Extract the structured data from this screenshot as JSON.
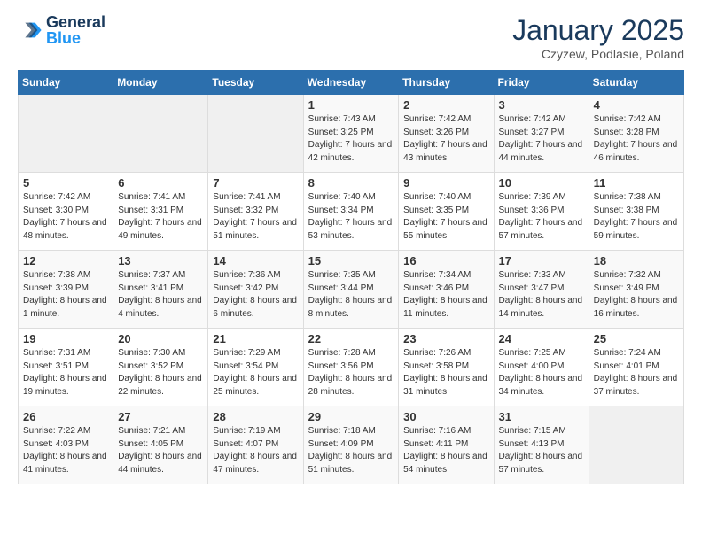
{
  "header": {
    "logo_general": "General",
    "logo_blue": "Blue",
    "month_title": "January 2025",
    "location": "Czyzew, Podlasie, Poland"
  },
  "weekdays": [
    "Sunday",
    "Monday",
    "Tuesday",
    "Wednesday",
    "Thursday",
    "Friday",
    "Saturday"
  ],
  "weeks": [
    [
      {
        "day": "",
        "info": ""
      },
      {
        "day": "",
        "info": ""
      },
      {
        "day": "",
        "info": ""
      },
      {
        "day": "1",
        "info": "Sunrise: 7:43 AM\nSunset: 3:25 PM\nDaylight: 7 hours and 42 minutes."
      },
      {
        "day": "2",
        "info": "Sunrise: 7:42 AM\nSunset: 3:26 PM\nDaylight: 7 hours and 43 minutes."
      },
      {
        "day": "3",
        "info": "Sunrise: 7:42 AM\nSunset: 3:27 PM\nDaylight: 7 hours and 44 minutes."
      },
      {
        "day": "4",
        "info": "Sunrise: 7:42 AM\nSunset: 3:28 PM\nDaylight: 7 hours and 46 minutes."
      }
    ],
    [
      {
        "day": "5",
        "info": "Sunrise: 7:42 AM\nSunset: 3:30 PM\nDaylight: 7 hours and 48 minutes."
      },
      {
        "day": "6",
        "info": "Sunrise: 7:41 AM\nSunset: 3:31 PM\nDaylight: 7 hours and 49 minutes."
      },
      {
        "day": "7",
        "info": "Sunrise: 7:41 AM\nSunset: 3:32 PM\nDaylight: 7 hours and 51 minutes."
      },
      {
        "day": "8",
        "info": "Sunrise: 7:40 AM\nSunset: 3:34 PM\nDaylight: 7 hours and 53 minutes."
      },
      {
        "day": "9",
        "info": "Sunrise: 7:40 AM\nSunset: 3:35 PM\nDaylight: 7 hours and 55 minutes."
      },
      {
        "day": "10",
        "info": "Sunrise: 7:39 AM\nSunset: 3:36 PM\nDaylight: 7 hours and 57 minutes."
      },
      {
        "day": "11",
        "info": "Sunrise: 7:38 AM\nSunset: 3:38 PM\nDaylight: 7 hours and 59 minutes."
      }
    ],
    [
      {
        "day": "12",
        "info": "Sunrise: 7:38 AM\nSunset: 3:39 PM\nDaylight: 8 hours and 1 minute."
      },
      {
        "day": "13",
        "info": "Sunrise: 7:37 AM\nSunset: 3:41 PM\nDaylight: 8 hours and 4 minutes."
      },
      {
        "day": "14",
        "info": "Sunrise: 7:36 AM\nSunset: 3:42 PM\nDaylight: 8 hours and 6 minutes."
      },
      {
        "day": "15",
        "info": "Sunrise: 7:35 AM\nSunset: 3:44 PM\nDaylight: 8 hours and 8 minutes."
      },
      {
        "day": "16",
        "info": "Sunrise: 7:34 AM\nSunset: 3:46 PM\nDaylight: 8 hours and 11 minutes."
      },
      {
        "day": "17",
        "info": "Sunrise: 7:33 AM\nSunset: 3:47 PM\nDaylight: 8 hours and 14 minutes."
      },
      {
        "day": "18",
        "info": "Sunrise: 7:32 AM\nSunset: 3:49 PM\nDaylight: 8 hours and 16 minutes."
      }
    ],
    [
      {
        "day": "19",
        "info": "Sunrise: 7:31 AM\nSunset: 3:51 PM\nDaylight: 8 hours and 19 minutes."
      },
      {
        "day": "20",
        "info": "Sunrise: 7:30 AM\nSunset: 3:52 PM\nDaylight: 8 hours and 22 minutes."
      },
      {
        "day": "21",
        "info": "Sunrise: 7:29 AM\nSunset: 3:54 PM\nDaylight: 8 hours and 25 minutes."
      },
      {
        "day": "22",
        "info": "Sunrise: 7:28 AM\nSunset: 3:56 PM\nDaylight: 8 hours and 28 minutes."
      },
      {
        "day": "23",
        "info": "Sunrise: 7:26 AM\nSunset: 3:58 PM\nDaylight: 8 hours and 31 minutes."
      },
      {
        "day": "24",
        "info": "Sunrise: 7:25 AM\nSunset: 4:00 PM\nDaylight: 8 hours and 34 minutes."
      },
      {
        "day": "25",
        "info": "Sunrise: 7:24 AM\nSunset: 4:01 PM\nDaylight: 8 hours and 37 minutes."
      }
    ],
    [
      {
        "day": "26",
        "info": "Sunrise: 7:22 AM\nSunset: 4:03 PM\nDaylight: 8 hours and 41 minutes."
      },
      {
        "day": "27",
        "info": "Sunrise: 7:21 AM\nSunset: 4:05 PM\nDaylight: 8 hours and 44 minutes."
      },
      {
        "day": "28",
        "info": "Sunrise: 7:19 AM\nSunset: 4:07 PM\nDaylight: 8 hours and 47 minutes."
      },
      {
        "day": "29",
        "info": "Sunrise: 7:18 AM\nSunset: 4:09 PM\nDaylight: 8 hours and 51 minutes."
      },
      {
        "day": "30",
        "info": "Sunrise: 7:16 AM\nSunset: 4:11 PM\nDaylight: 8 hours and 54 minutes."
      },
      {
        "day": "31",
        "info": "Sunrise: 7:15 AM\nSunset: 4:13 PM\nDaylight: 8 hours and 57 minutes."
      },
      {
        "day": "",
        "info": ""
      }
    ]
  ]
}
